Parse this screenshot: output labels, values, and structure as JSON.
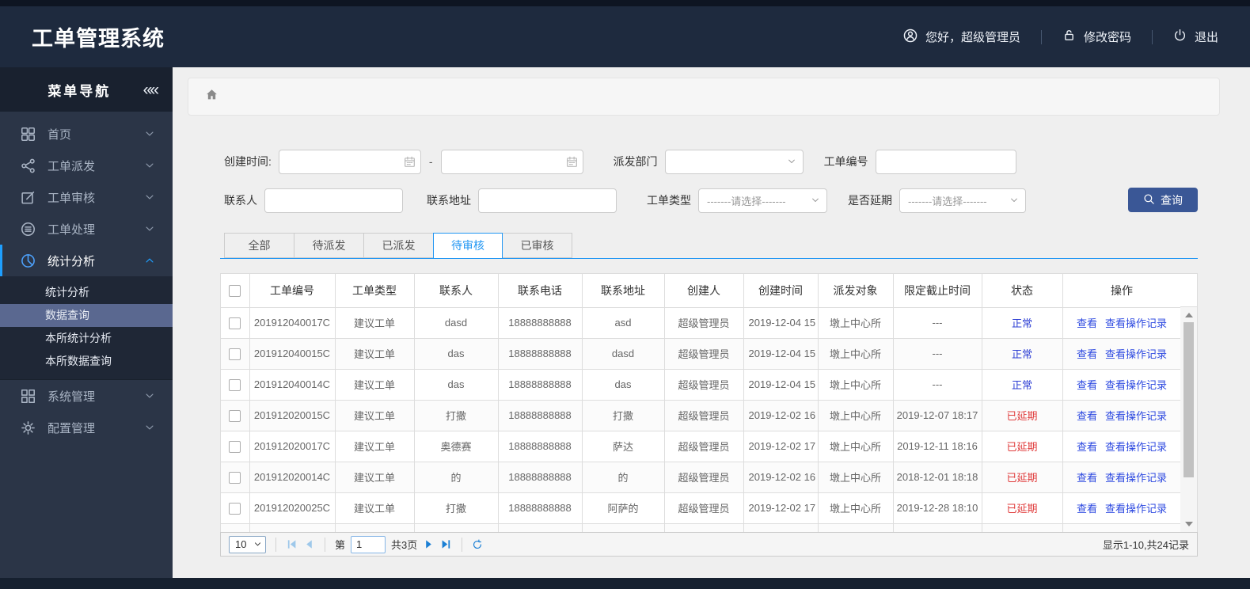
{
  "colors": {
    "accent": "#1e9fff",
    "link": "#2c48e0",
    "button": "#3a5796",
    "status_normal": "#2e3fd4",
    "status_delayed": "#e03c3c"
  },
  "header": {
    "title": "工单管理系统",
    "greeting": "您好，超级管理员",
    "change_password": "修改密码",
    "logout": "退出"
  },
  "sidebar": {
    "title": "菜单导航",
    "collapse_icon": "««",
    "items": [
      {
        "label": "首页",
        "icon": "dashboard-icon",
        "expanded": false
      },
      {
        "label": "工单派发",
        "icon": "share-icon",
        "expanded": false
      },
      {
        "label": "工单审核",
        "icon": "edit-icon",
        "expanded": false
      },
      {
        "label": "工单处理",
        "icon": "process-icon",
        "expanded": false
      },
      {
        "label": "统计分析",
        "icon": "pie-chart-icon",
        "expanded": true,
        "children": [
          "统计分析",
          "数据查询",
          "本所统计分析",
          "本所数据查询"
        ],
        "selected_child": "数据查询"
      },
      {
        "label": "系统管理",
        "icon": "grid-icon",
        "expanded": false
      },
      {
        "label": "配置管理",
        "icon": "gear-icon",
        "expanded": false
      }
    ]
  },
  "filters": {
    "create_time_label": "创建时间:",
    "range_separator": "-",
    "dispatch_dept_label": "派发部门",
    "order_no_label": "工单编号",
    "contact_label": "联系人",
    "address_label": "联系地址",
    "order_type_label": "工单类型",
    "delay_label": "是否延期",
    "select_placeholder": "-------请选择-------",
    "search_button": "查询"
  },
  "tabs": [
    {
      "label": "全部",
      "active": false
    },
    {
      "label": "待派发",
      "active": false
    },
    {
      "label": "已派发",
      "active": false
    },
    {
      "label": "待审核",
      "active": true
    },
    {
      "label": "已审核",
      "active": false
    }
  ],
  "table": {
    "columns": [
      "工单编号",
      "工单类型",
      "联系人",
      "联系电话",
      "联系地址",
      "创建人",
      "创建时间",
      "派发对象",
      "限定截止时间",
      "状态",
      "操作"
    ],
    "actions": [
      "查看",
      "查看操作记录"
    ],
    "rows": [
      {
        "id": "201912040017C",
        "type": "建议工单",
        "contact": "dasd",
        "phone": "18888888888",
        "address": "asd",
        "creator": "超级管理员",
        "created": "2019-12-04 15",
        "target": "墩上中心所",
        "deadline": "---",
        "status": "正常",
        "status_kind": "normal"
      },
      {
        "id": "201912040015C",
        "type": "建议工单",
        "contact": "das",
        "phone": "18888888888",
        "address": "dasd",
        "creator": "超级管理员",
        "created": "2019-12-04 15",
        "target": "墩上中心所",
        "deadline": "---",
        "status": "正常",
        "status_kind": "normal"
      },
      {
        "id": "201912040014C",
        "type": "建议工单",
        "contact": "das",
        "phone": "18888888888",
        "address": "das",
        "creator": "超级管理员",
        "created": "2019-12-04 15",
        "target": "墩上中心所",
        "deadline": "---",
        "status": "正常",
        "status_kind": "normal"
      },
      {
        "id": "201912020015C",
        "type": "建议工单",
        "contact": "打撒",
        "phone": "18888888888",
        "address": "打撒",
        "creator": "超级管理员",
        "created": "2019-12-02 16",
        "target": "墩上中心所",
        "deadline": "2019-12-07 18:17",
        "status": "已延期",
        "status_kind": "delayed"
      },
      {
        "id": "201912020017C",
        "type": "建议工单",
        "contact": "奥德赛",
        "phone": "18888888888",
        "address": "萨达",
        "creator": "超级管理员",
        "created": "2019-12-02 17",
        "target": "墩上中心所",
        "deadline": "2019-12-11 18:16",
        "status": "已延期",
        "status_kind": "delayed"
      },
      {
        "id": "201912020014C",
        "type": "建议工单",
        "contact": "的",
        "phone": "18888888888",
        "address": "的",
        "creator": "超级管理员",
        "created": "2019-12-02 16",
        "target": "墩上中心所",
        "deadline": "2018-12-01 18:18",
        "status": "已延期",
        "status_kind": "delayed"
      },
      {
        "id": "201912020025C",
        "type": "建议工单",
        "contact": "打撒",
        "phone": "18888888888",
        "address": "阿萨的",
        "creator": "超级管理员",
        "created": "2019-12-02 17",
        "target": "墩上中心所",
        "deadline": "2019-12-28 18:10",
        "status": "已延期",
        "status_kind": "delayed"
      }
    ],
    "partial_row": true
  },
  "pagination": {
    "page_size": "10",
    "page_prefix": "第",
    "current_page": "1",
    "total_pages": "共3页",
    "summary": "显示1-10,共24记录"
  }
}
